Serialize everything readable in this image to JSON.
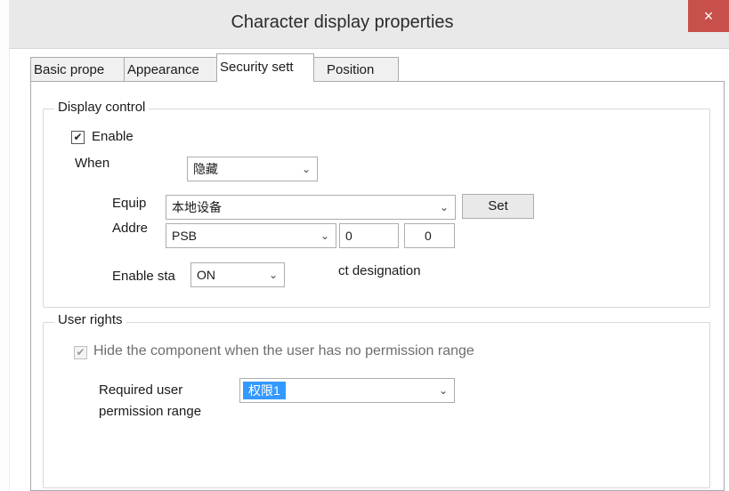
{
  "window": {
    "title": "Character display properties",
    "close_glyph": "×"
  },
  "tabs": [
    {
      "label": "Basic prope"
    },
    {
      "label": "Appearance"
    },
    {
      "label": "Security sett"
    },
    {
      "label": "Position"
    }
  ],
  "display_control": {
    "legend": "Display control",
    "enable_label": "Enable",
    "enable_checked": true,
    "when_label": "When",
    "when_value": "隐藏",
    "equip_label": "Equip",
    "equip_value": "本地设备",
    "set_button": "Set",
    "addr_label": "Addre",
    "addr_type": "PSB",
    "addr_value1": "0",
    "addr_value2": "0",
    "enable_state_label": "Enable sta",
    "enable_state_value": "ON",
    "designation_text": "ct designation"
  },
  "user_rights": {
    "legend": "User rights",
    "hide_label": "Hide the component when the user has no permission range",
    "hide_checked": true,
    "required_label_line1": "Required user",
    "required_label_line2": "permission range",
    "permission_value": "权限1"
  },
  "icons": {
    "check": "check-icon",
    "dropdown": "chevron-down-icon",
    "close": "close-icon"
  },
  "colors": {
    "selection": "#3399ff",
    "close_button": "#c7504b"
  }
}
